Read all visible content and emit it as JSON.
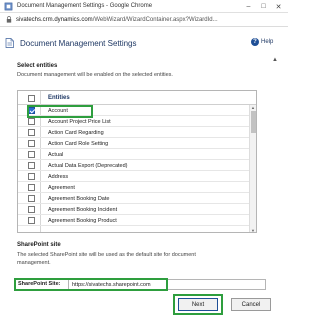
{
  "window": {
    "title": "Document Management Settings - Google Chrome",
    "minimize": "–",
    "maximize": "□",
    "close": "✕"
  },
  "address": {
    "domain": "sivatechs.crm.dynamics.com",
    "path": "/WebWizard/WizardContainer.aspx?WizardId..."
  },
  "dialog": {
    "title": "Document Management Settings",
    "help_label": "Help",
    "help_glyph": "?"
  },
  "select_entities": {
    "heading": "Select entities",
    "description": "Document management will be enabled on the selected entities."
  },
  "grid": {
    "column_header": "Entities",
    "rows": [
      {
        "label": "Account",
        "checked": true
      },
      {
        "label": "Account Project Price List",
        "checked": false
      },
      {
        "label": "Action Card Regarding",
        "checked": false
      },
      {
        "label": "Action Card Role Setting",
        "checked": false
      },
      {
        "label": "Actual",
        "checked": false
      },
      {
        "label": "Actual Data Export (Deprecated)",
        "checked": false
      },
      {
        "label": "Address",
        "checked": false
      },
      {
        "label": "Agreement",
        "checked": false
      },
      {
        "label": "Agreement Booking Date",
        "checked": false
      },
      {
        "label": "Agreement Booking Incident",
        "checked": false
      },
      {
        "label": "Agreement Booking Product",
        "checked": false
      }
    ]
  },
  "sharepoint": {
    "heading": "SharePoint site",
    "description_line1": "The selected SharePoint site will be used as the default site for document",
    "description_line2": "management.",
    "field_label": "SharePoint Site:",
    "field_value": "https://sivatechs.sharepoint.com"
  },
  "buttons": {
    "next_label": "Next",
    "cancel_label": "Cancel"
  },
  "colors": {
    "highlight": "#2e9e3e",
    "accent": "#1f4f96",
    "title_text": "#1f3864"
  }
}
